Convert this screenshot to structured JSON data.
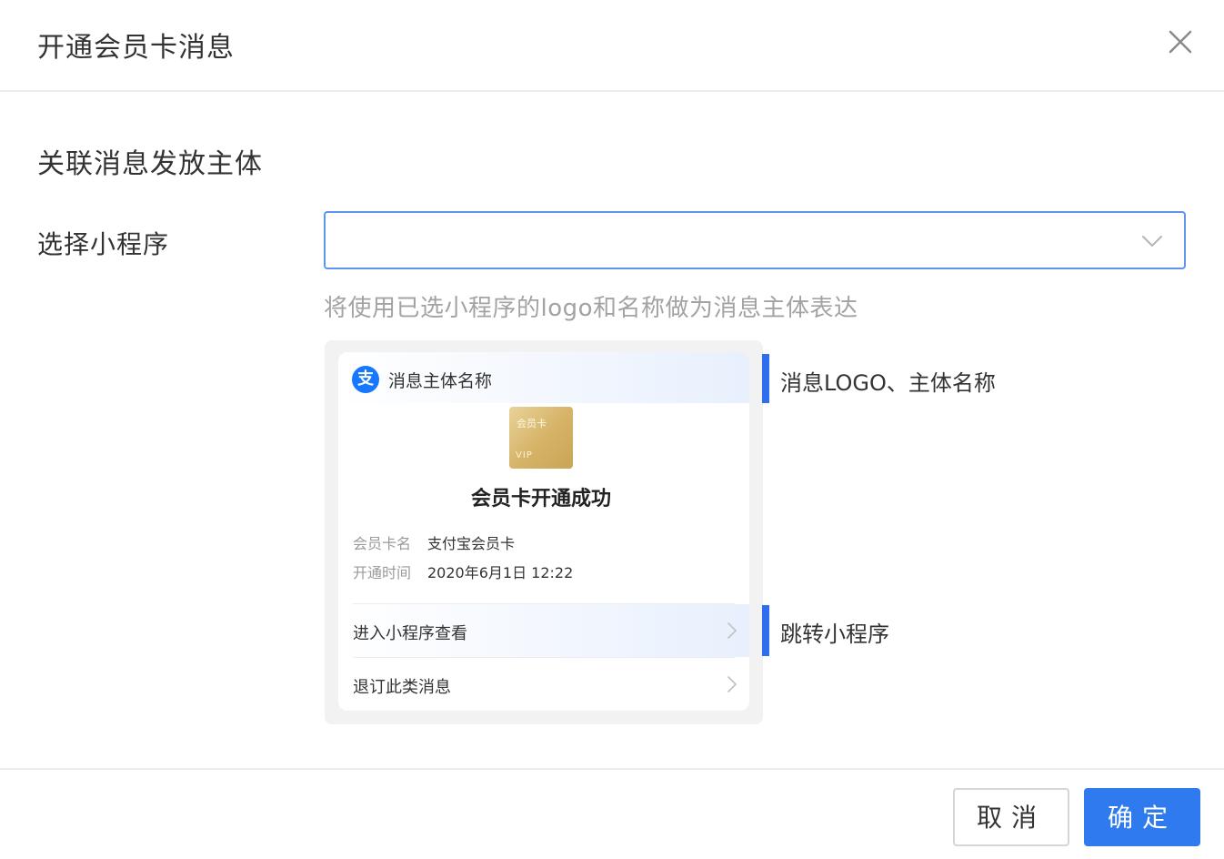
{
  "dialog": {
    "title": "开通会员卡消息",
    "close_icon": "close-icon"
  },
  "section": {
    "title": "关联消息发放主体"
  },
  "form": {
    "label": "选择小程序",
    "select_value": "",
    "hint": "将使用已选小程序的logo和名称做为消息主体表达"
  },
  "preview": {
    "sender_icon": "alipay-icon",
    "sender_icon_glyph": "支",
    "sender_name": "消息主体名称",
    "vip_card_label": "会员卡",
    "vip_card_text": "VIP",
    "card_title": "会员卡开通成功",
    "details": [
      {
        "key": "会员卡名",
        "value": "支付宝会员卡"
      },
      {
        "key": "开通时间",
        "value": "2020年6月1日 12:22"
      }
    ],
    "actions": [
      {
        "label": "进入小程序查看"
      },
      {
        "label": "退订此类消息"
      }
    ]
  },
  "annotations": {
    "logo": "消息LOGO、主体名称",
    "jump": "跳转小程序",
    "accent_color": "#2f6fef"
  },
  "footer": {
    "cancel_label": "取消",
    "ok_label": "确定",
    "ok_color": "#2f7aef"
  }
}
